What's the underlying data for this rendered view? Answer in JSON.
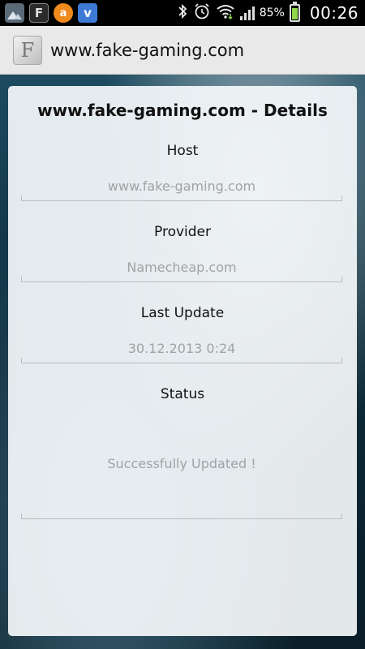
{
  "status_bar": {
    "icons_left": [
      "gallery-icon",
      "f-app-icon",
      "avast-icon",
      "v-app-icon"
    ],
    "f_letter": "F",
    "avast_letter": "a",
    "v_letter": "v",
    "battery_percent": "85%",
    "time": "00:26",
    "icons_right": [
      "bluetooth-icon",
      "alarm-icon",
      "wifi-icon",
      "signal-icon",
      "battery-icon"
    ]
  },
  "action_bar": {
    "app_icon_letter": "F",
    "title": "www.fake-gaming.com"
  },
  "details": {
    "title": "www.fake-gaming.com - Details",
    "host_label": "Host",
    "host_value": "www.fake-gaming.com",
    "provider_label": "Provider",
    "provider_value": "Namecheap.com",
    "last_update_label": "Last Update",
    "last_update_value": "30.12.2013 0:24",
    "status_label": "Status",
    "status_value": "Successfully Updated !"
  },
  "colors": {
    "status_bar_bg": "#000000",
    "action_bar_bg": "#e9e9e9",
    "value_text": "#a0a3a5",
    "battery_fill": "#8fd64a"
  }
}
